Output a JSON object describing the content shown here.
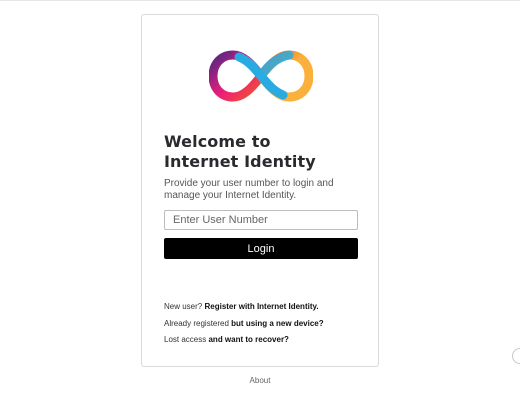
{
  "login": {
    "logo_icon": "infinity-logo",
    "title_line1": "Welcome to",
    "title_line2": "Internet Identity",
    "subtitle": "Provide your user number to login and manage your Internet Identity.",
    "user_number": {
      "value": "",
      "placeholder": "Enter User Number"
    },
    "login_label": "Login",
    "register": {
      "prefix": "New user?",
      "link": "Register with Internet Identity."
    },
    "new_device": {
      "prefix": "Already registered",
      "link": "but using a new device?"
    },
    "recover": {
      "prefix": "Lost access",
      "link": "and want to recover?"
    }
  },
  "footer": {
    "about_label": "About"
  },
  "colors": {
    "button_bg": "#000000",
    "button_text": "#ffffff",
    "logo_gradient_left": [
      "#f15a24",
      "#ed1e79",
      "#522785"
    ],
    "logo_gradient_right": [
      "#fbb03b",
      "#29abe2"
    ]
  }
}
